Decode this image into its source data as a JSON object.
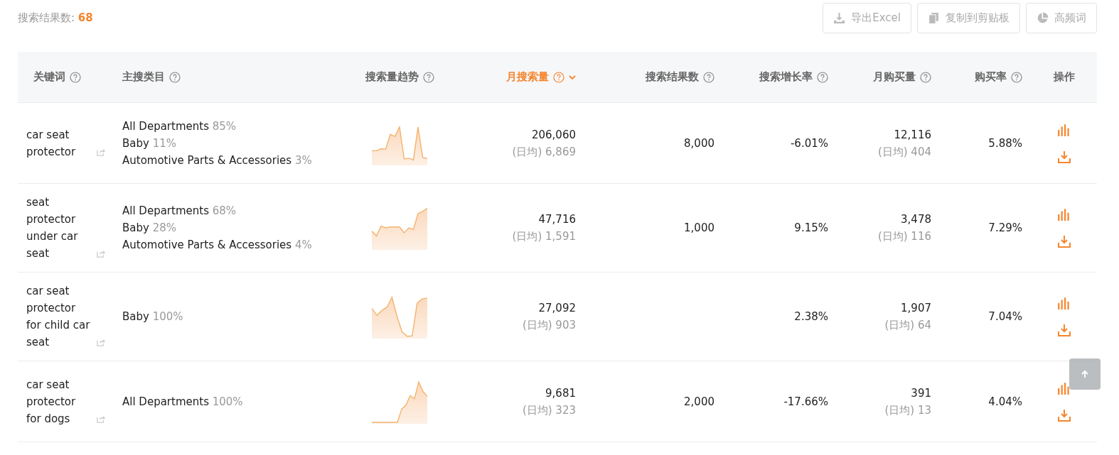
{
  "summary": {
    "label": "搜索结果数:",
    "count": "68"
  },
  "toolbar": [
    {
      "kind": "export",
      "label": "导出Excel"
    },
    {
      "kind": "copy",
      "label": "复制到剪贴板"
    },
    {
      "kind": "words",
      "label": "高频词"
    }
  ],
  "table": {
    "columns": [
      {
        "label": "关键词",
        "help": true,
        "sorted": false
      },
      {
        "label": "主搜类目",
        "help": true,
        "sorted": false
      },
      {
        "label": "搜索量趋势",
        "help": true,
        "sorted": false
      },
      {
        "label": "月搜索量",
        "help": true,
        "sorted": true
      },
      {
        "label": "搜索结果数",
        "help": true,
        "sorted": false
      },
      {
        "label": "搜索增长率",
        "help": true,
        "sorted": false
      },
      {
        "label": "月购买量",
        "help": true,
        "sorted": false
      },
      {
        "label": "购买率",
        "help": true,
        "sorted": false
      },
      {
        "label": "操作",
        "help": false,
        "sorted": false
      }
    ],
    "rows": [
      {
        "keyword": "car seat protector",
        "categories": [
          {
            "name": "All Departments",
            "share": "85%"
          },
          {
            "name": "Baby",
            "share": "11%"
          },
          {
            "name": "Automotive Parts & Accessories",
            "share": "3%"
          }
        ],
        "monthly_searches": "206,060",
        "daily_searches": "(日均) 6,869",
        "search_results": "8,000",
        "growth": "-6.01%",
        "monthly_purchases": "12,116",
        "daily_purchases": "(日均) 404",
        "purchase_rate": "5.88%"
      },
      {
        "keyword": "seat protector under car seat",
        "categories": [
          {
            "name": "All Departments",
            "share": "68%"
          },
          {
            "name": "Baby",
            "share": "28%"
          },
          {
            "name": "Automotive Parts & Accessories",
            "share": "4%"
          }
        ],
        "monthly_searches": "47,716",
        "daily_searches": "(日均) 1,591",
        "search_results": "1,000",
        "growth": "9.15%",
        "monthly_purchases": "3,478",
        "daily_purchases": "(日均) 116",
        "purchase_rate": "7.29%"
      },
      {
        "keyword": "car seat protector for child car seat",
        "categories": [
          {
            "name": "Baby",
            "share": "100%"
          }
        ],
        "monthly_searches": "27,092",
        "daily_searches": "(日均) 903",
        "growth": "2.38%",
        "monthly_purchases": "1,907",
        "daily_purchases": "(日均) 64",
        "purchase_rate": "7.04%"
      },
      {
        "keyword": "car seat protector for dogs",
        "categories": [
          {
            "name": "All Departments",
            "share": "100%"
          }
        ],
        "monthly_searches": "9,681",
        "daily_searches": "(日均) 323",
        "search_results": "2,000",
        "growth": "-17.66%",
        "monthly_purchases": "391",
        "daily_purchases": "(日均) 13",
        "purchase_rate": "4.04%"
      }
    ]
  }
}
